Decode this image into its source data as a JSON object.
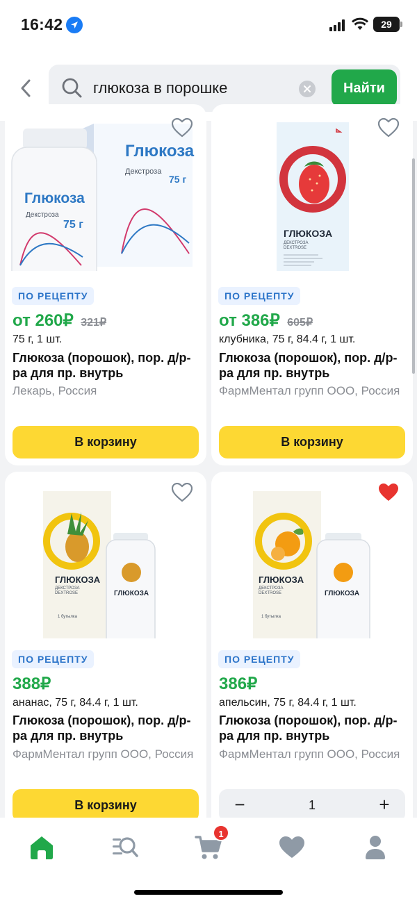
{
  "status_bar": {
    "time": "16:42",
    "battery": "29"
  },
  "search": {
    "query": "глюкоза в порошке",
    "find_label": "Найти"
  },
  "colors": {
    "accent_green": "#21a84a",
    "cart_yellow": "#fdd833",
    "badge_blue": "#2c74c9",
    "favorite_red": "#e8342f"
  },
  "products": [
    {
      "badge": "ПО РЕЦЕПТУ",
      "price": "от 260₽",
      "old_price": "321₽",
      "variant": "75 г, 1 шт.",
      "name": "Глюкоза (порошок), пор. д/р-ра для пр. внутрь",
      "manufacturer": "Лекарь, Россия",
      "action_label": "В корзину",
      "favorite": false,
      "image_icon": "glucose-bottle-and-box"
    },
    {
      "badge": "ПО РЕЦЕПТУ",
      "price": "от 386₽",
      "old_price": "605₽",
      "variant": "клубника, 75 г, 84.4 г, 1 шт.",
      "name": "Глюкоза (порошок), пор. д/р-ра для пр. внутрь",
      "manufacturer": "ФармМентал групп ООО, Россия",
      "action_label": "В корзину",
      "favorite": false,
      "image_icon": "strawberry-box"
    },
    {
      "badge": "ПО РЕЦЕПТУ",
      "price": "388₽",
      "variant": "ананас, 75 г, 84.4 г, 1 шт.",
      "name": "Глюкоза (порошок), пор. д/р-ра для пр. внутрь",
      "manufacturer": "ФармМентал групп ООО, Россия",
      "action_label": "В корзину",
      "favorite": false,
      "image_icon": "pineapple-box-and-bottle"
    },
    {
      "badge": "ПО РЕЦЕПТУ",
      "price": "386₽",
      "variant": "апельсин, 75 г, 84.4 г, 1 шт.",
      "name": "Глюкоза (порошок), пор. д/р-ра для пр. внутрь",
      "manufacturer": "ФармМентал групп ООО, Россия",
      "quantity": "1",
      "favorite": true,
      "image_icon": "orange-box-and-bottle"
    }
  ],
  "package_text": {
    "glucose": "Глюкоза",
    "dextrose": "Декстроза",
    "weight": "75 г",
    "glucose_caps": "ГЛЮКОЗА",
    "dextrose_caps": "ДЕКСТРОЗА",
    "dextrose_latin": "DEXTROSE",
    "one_bottle": "1 бутылка",
    "pack_weight_1": "75 г",
    "pack_weight_2": "84,4 г"
  },
  "tab_bar": {
    "tabs": [
      {
        "icon": "home-icon",
        "active": true
      },
      {
        "icon": "catalog-search-icon",
        "active": false
      },
      {
        "icon": "cart-icon",
        "active": false
      },
      {
        "icon": "heart-icon",
        "active": false
      },
      {
        "icon": "profile-icon",
        "active": false
      }
    ],
    "cart_count": "1"
  }
}
